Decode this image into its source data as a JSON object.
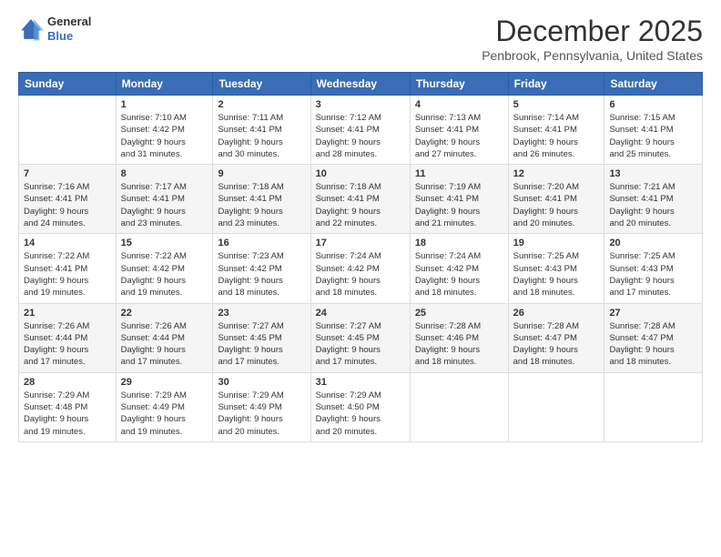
{
  "header": {
    "logo": {
      "general": "General",
      "blue": "Blue"
    },
    "title": "December 2025",
    "subtitle": "Penbrook, Pennsylvania, United States"
  },
  "days_of_week": [
    "Sunday",
    "Monday",
    "Tuesday",
    "Wednesday",
    "Thursday",
    "Friday",
    "Saturday"
  ],
  "weeks": [
    [
      {
        "day": "",
        "info": ""
      },
      {
        "day": "1",
        "info": "Sunrise: 7:10 AM\nSunset: 4:42 PM\nDaylight: 9 hours\nand 31 minutes."
      },
      {
        "day": "2",
        "info": "Sunrise: 7:11 AM\nSunset: 4:41 PM\nDaylight: 9 hours\nand 30 minutes."
      },
      {
        "day": "3",
        "info": "Sunrise: 7:12 AM\nSunset: 4:41 PM\nDaylight: 9 hours\nand 28 minutes."
      },
      {
        "day": "4",
        "info": "Sunrise: 7:13 AM\nSunset: 4:41 PM\nDaylight: 9 hours\nand 27 minutes."
      },
      {
        "day": "5",
        "info": "Sunrise: 7:14 AM\nSunset: 4:41 PM\nDaylight: 9 hours\nand 26 minutes."
      },
      {
        "day": "6",
        "info": "Sunrise: 7:15 AM\nSunset: 4:41 PM\nDaylight: 9 hours\nand 25 minutes."
      }
    ],
    [
      {
        "day": "7",
        "info": "Sunrise: 7:16 AM\nSunset: 4:41 PM\nDaylight: 9 hours\nand 24 minutes."
      },
      {
        "day": "8",
        "info": "Sunrise: 7:17 AM\nSunset: 4:41 PM\nDaylight: 9 hours\nand 23 minutes."
      },
      {
        "day": "9",
        "info": "Sunrise: 7:18 AM\nSunset: 4:41 PM\nDaylight: 9 hours\nand 23 minutes."
      },
      {
        "day": "10",
        "info": "Sunrise: 7:18 AM\nSunset: 4:41 PM\nDaylight: 9 hours\nand 22 minutes."
      },
      {
        "day": "11",
        "info": "Sunrise: 7:19 AM\nSunset: 4:41 PM\nDaylight: 9 hours\nand 21 minutes."
      },
      {
        "day": "12",
        "info": "Sunrise: 7:20 AM\nSunset: 4:41 PM\nDaylight: 9 hours\nand 20 minutes."
      },
      {
        "day": "13",
        "info": "Sunrise: 7:21 AM\nSunset: 4:41 PM\nDaylight: 9 hours\nand 20 minutes."
      }
    ],
    [
      {
        "day": "14",
        "info": "Sunrise: 7:22 AM\nSunset: 4:41 PM\nDaylight: 9 hours\nand 19 minutes."
      },
      {
        "day": "15",
        "info": "Sunrise: 7:22 AM\nSunset: 4:42 PM\nDaylight: 9 hours\nand 19 minutes."
      },
      {
        "day": "16",
        "info": "Sunrise: 7:23 AM\nSunset: 4:42 PM\nDaylight: 9 hours\nand 18 minutes."
      },
      {
        "day": "17",
        "info": "Sunrise: 7:24 AM\nSunset: 4:42 PM\nDaylight: 9 hours\nand 18 minutes."
      },
      {
        "day": "18",
        "info": "Sunrise: 7:24 AM\nSunset: 4:42 PM\nDaylight: 9 hours\nand 18 minutes."
      },
      {
        "day": "19",
        "info": "Sunrise: 7:25 AM\nSunset: 4:43 PM\nDaylight: 9 hours\nand 18 minutes."
      },
      {
        "day": "20",
        "info": "Sunrise: 7:25 AM\nSunset: 4:43 PM\nDaylight: 9 hours\nand 17 minutes."
      }
    ],
    [
      {
        "day": "21",
        "info": "Sunrise: 7:26 AM\nSunset: 4:44 PM\nDaylight: 9 hours\nand 17 minutes."
      },
      {
        "day": "22",
        "info": "Sunrise: 7:26 AM\nSunset: 4:44 PM\nDaylight: 9 hours\nand 17 minutes."
      },
      {
        "day": "23",
        "info": "Sunrise: 7:27 AM\nSunset: 4:45 PM\nDaylight: 9 hours\nand 17 minutes."
      },
      {
        "day": "24",
        "info": "Sunrise: 7:27 AM\nSunset: 4:45 PM\nDaylight: 9 hours\nand 17 minutes."
      },
      {
        "day": "25",
        "info": "Sunrise: 7:28 AM\nSunset: 4:46 PM\nDaylight: 9 hours\nand 18 minutes."
      },
      {
        "day": "26",
        "info": "Sunrise: 7:28 AM\nSunset: 4:47 PM\nDaylight: 9 hours\nand 18 minutes."
      },
      {
        "day": "27",
        "info": "Sunrise: 7:28 AM\nSunset: 4:47 PM\nDaylight: 9 hours\nand 18 minutes."
      }
    ],
    [
      {
        "day": "28",
        "info": "Sunrise: 7:29 AM\nSunset: 4:48 PM\nDaylight: 9 hours\nand 19 minutes."
      },
      {
        "day": "29",
        "info": "Sunrise: 7:29 AM\nSunset: 4:49 PM\nDaylight: 9 hours\nand 19 minutes."
      },
      {
        "day": "30",
        "info": "Sunrise: 7:29 AM\nSunset: 4:49 PM\nDaylight: 9 hours\nand 20 minutes."
      },
      {
        "day": "31",
        "info": "Sunrise: 7:29 AM\nSunset: 4:50 PM\nDaylight: 9 hours\nand 20 minutes."
      },
      {
        "day": "",
        "info": ""
      },
      {
        "day": "",
        "info": ""
      },
      {
        "day": "",
        "info": ""
      }
    ]
  ]
}
